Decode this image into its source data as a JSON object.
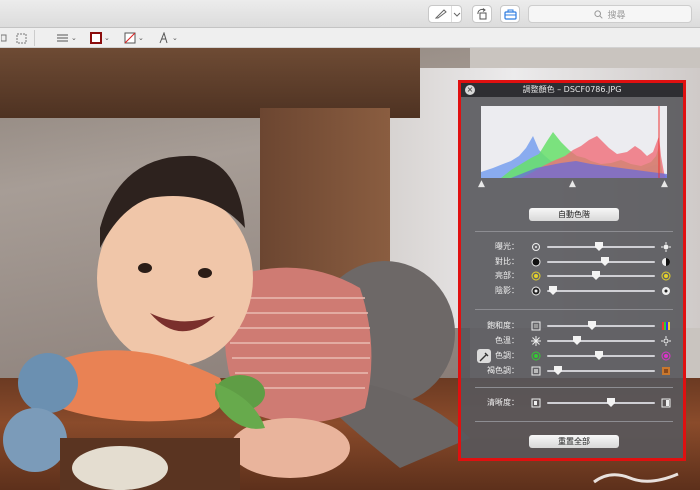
{
  "toolbar": {
    "search_placeholder": "搜尋"
  },
  "panel": {
    "title": "調整顏色 – DSCF0786.JPG",
    "auto_levels": "自動色階",
    "reset_all": "重置全部",
    "sliders": [
      {
        "key": "exposure",
        "label": "曝光：",
        "value": 0.48
      },
      {
        "key": "contrast",
        "label": "對比：",
        "value": 0.54
      },
      {
        "key": "highlights",
        "label": "亮部：",
        "value": 0.45
      },
      {
        "key": "shadows",
        "label": "陰影：",
        "value": 0.06
      },
      {
        "key": "saturation",
        "label": "飽和度：",
        "value": 0.42
      },
      {
        "key": "temperature",
        "label": "色溫：",
        "value": 0.28
      },
      {
        "key": "tint",
        "label": "色調：",
        "value": 0.48
      },
      {
        "key": "sepia",
        "label": "褐色調：",
        "value": 0.1
      },
      {
        "key": "sharpness",
        "label": "清晰度：",
        "value": 0.59
      }
    ]
  },
  "colors": {
    "frame": "#e01010",
    "accent": "#2f7de1"
  },
  "photo": {
    "caption": "baby crawling on floor with carrot plush toy"
  }
}
